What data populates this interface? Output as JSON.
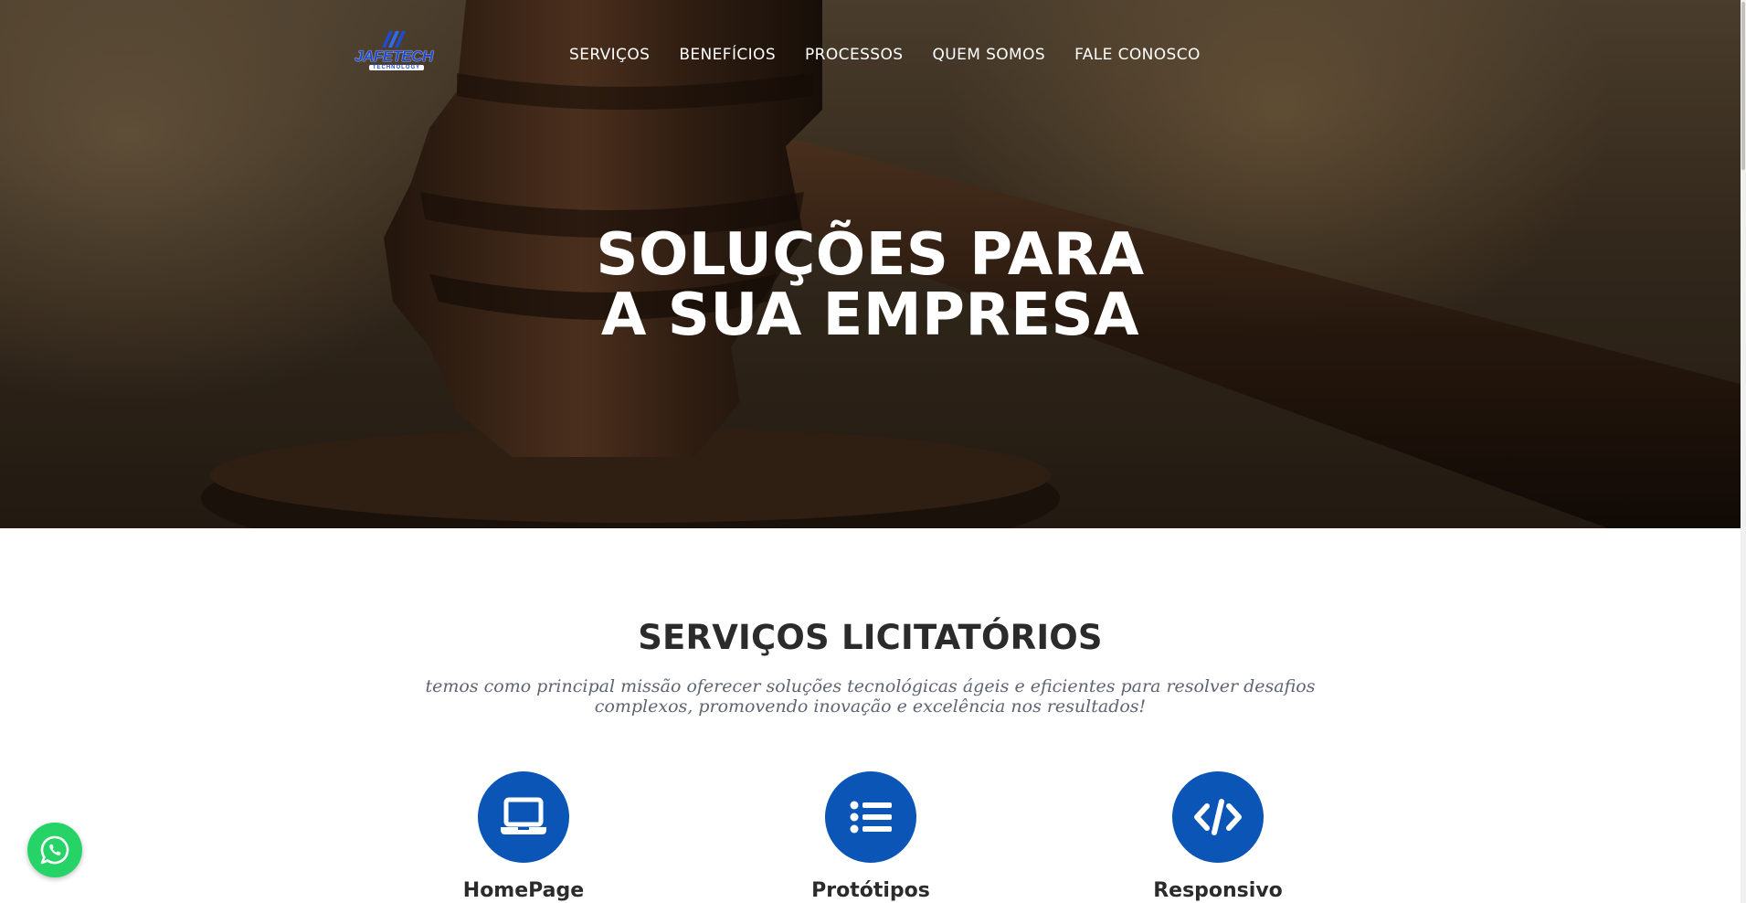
{
  "brand": {
    "logo_text": "JAFETECH",
    "logo_subtext": "TECHNOLOGY",
    "logo_color": "#1e4bd2"
  },
  "nav": {
    "items": [
      {
        "label": "SERVIÇOS"
      },
      {
        "label": "BENEFÍCIOS"
      },
      {
        "label": "PROCESSOS"
      },
      {
        "label": "QUEM SOMOS"
      },
      {
        "label": "FALE CONOSCO"
      }
    ]
  },
  "hero": {
    "title_line1": "SOLUÇÕES PARA",
    "title_line2": "A SUA EMPRESA"
  },
  "services": {
    "title": "SERVIÇOS LICITATÓRIOS",
    "subtitle": "temos como principal missão oferecer soluções tecnológicas ágeis e eficientes para resolver desafios complexos, promovendo inovação e excelência nos resultados!",
    "accent": "#0b55b6",
    "items": [
      {
        "label": "HomePage",
        "icon": "laptop-icon"
      },
      {
        "label": "Protótipos",
        "icon": "list-icon"
      },
      {
        "label": "Responsivo",
        "icon": "code-icon"
      }
    ]
  },
  "whatsapp": {
    "icon": "whatsapp-icon",
    "color": "#25d366"
  }
}
